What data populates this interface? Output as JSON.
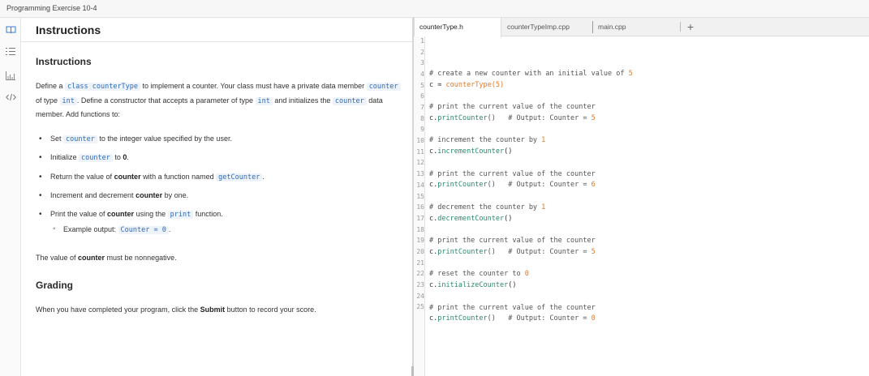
{
  "window": {
    "title": "Programming Exercise 10-4"
  },
  "rail": {
    "icons": [
      "book-icon",
      "list-icon",
      "chart-icon",
      "code-icon"
    ]
  },
  "left_panel": {
    "header": "Instructions",
    "section_instructions": "Instructions",
    "p1": {
      "t1": "Define a ",
      "c1": "class counterType",
      "t2": " to implement a counter. Your class must have a private data member ",
      "c2": "counter",
      "t3": " of type ",
      "c3": "int",
      "t4": ". Define a constructor that accepts a parameter of type ",
      "c4": "int",
      "t5": " and initializes the ",
      "c5": "counter",
      "t6": " data member. Add functions to:"
    },
    "bullets": {
      "b1": {
        "t1": "Set ",
        "c1": "counter",
        "t2": " to the integer value specified by the user."
      },
      "b2": {
        "t1": "Initialize ",
        "c1": "counter",
        "t2": " to ",
        "bold": "0",
        "t3": "."
      },
      "b3": {
        "t1": "Return the value of ",
        "bold": "counter",
        "t2": " with a function named ",
        "c1": "getCounter",
        "t3": "."
      },
      "b4": {
        "t1": "Increment and decrement ",
        "bold": "counter",
        "t2": " by one."
      },
      "b5": {
        "t1": "Print the value of ",
        "bold": "counter",
        "t2": " using the ",
        "c1": "print",
        "t3": " function."
      },
      "sub1": {
        "t1": "Example output: ",
        "c1": "Counter = 0",
        "t2": "."
      }
    },
    "p2": {
      "t1": "The value of ",
      "bold": "counter",
      "t2": " must be nonnegative."
    },
    "section_grading": "Grading",
    "p3": {
      "t1": "When you have completed your program, click the ",
      "bold": "Submit",
      "t2": " button to record your score."
    }
  },
  "editor": {
    "tabs": [
      "counterType.h",
      "counterTypeImp.cpp",
      "main.cpp"
    ],
    "active_tab": 0,
    "add_tab": "+",
    "line_numbers": [
      "1",
      "2",
      "3",
      "4",
      "5",
      "6",
      "7",
      "8",
      "9",
      "10",
      "11",
      "12",
      "13",
      "14",
      "15",
      "16",
      "17",
      "18",
      "19",
      "20",
      "21",
      "22",
      "23",
      "24",
      "25"
    ],
    "lines": {
      "l2": {
        "a": "# create a new counter with an initial value of ",
        "b": "5"
      },
      "l3": {
        "a": "c = ",
        "b": "counterType",
        "c": "(",
        "d": "5",
        "e": ")"
      },
      "l5": {
        "a": "# print the current value of the counter"
      },
      "l6": {
        "a": "c.",
        "b": "printCounter",
        "c": "()   # Output: Counter = ",
        "d": "5"
      },
      "l8": {
        "a": "# increment the counter by ",
        "b": "1"
      },
      "l9": {
        "a": "c.",
        "b": "incrementCounter",
        "c": "()"
      },
      "l11": {
        "a": "# print the current value of the counter"
      },
      "l12": {
        "a": "c.",
        "b": "printCounter",
        "c": "()   # Output: Counter = ",
        "d": "6"
      },
      "l14": {
        "a": "# decrement the counter by ",
        "b": "1"
      },
      "l15": {
        "a": "c.",
        "b": "decrementCounter",
        "c": "()"
      },
      "l17": {
        "a": "# print the current value of the counter"
      },
      "l18": {
        "a": "c.",
        "b": "printCounter",
        "c": "()   # Output: Counter = ",
        "d": "5"
      },
      "l20": {
        "a": "# reset the counter to ",
        "b": "0"
      },
      "l21": {
        "a": "c.",
        "b": "initializeCounter",
        "c": "()"
      },
      "l23": {
        "a": "# print the current value of the counter"
      },
      "l24": {
        "a": "c.",
        "b": "printCounter",
        "c": "()   # Output: Counter = ",
        "d": "0"
      }
    }
  },
  "colors": {
    "code_accent": "#2f6ab8",
    "number": "#e07a2e",
    "function": "#2a8a6a"
  }
}
